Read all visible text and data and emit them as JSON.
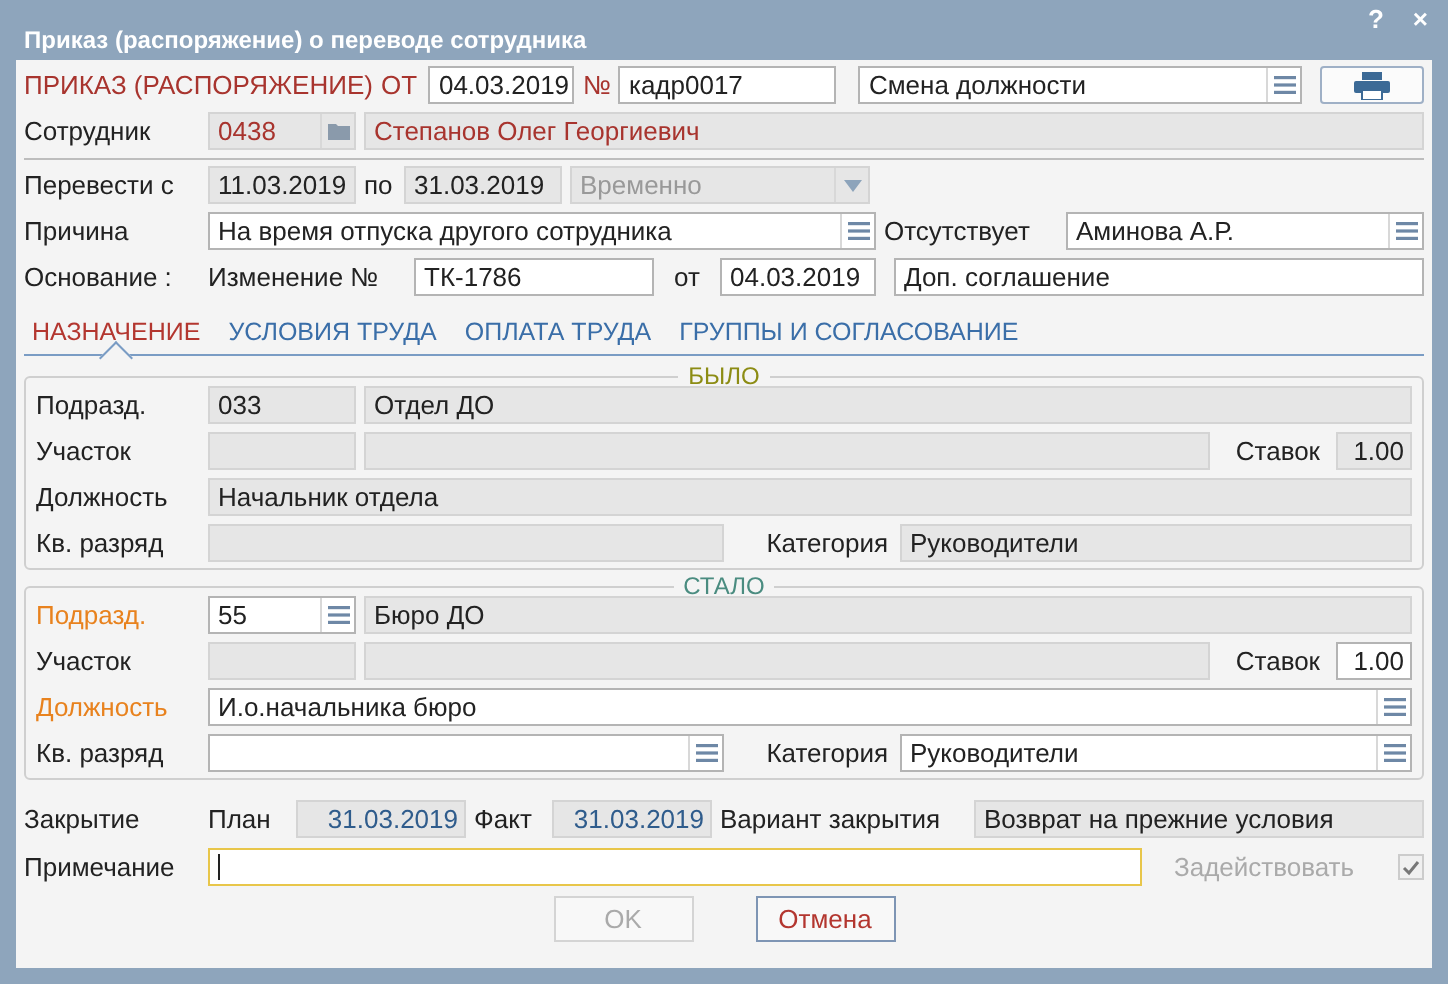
{
  "window": {
    "title": "Приказ (распоряжение) о переводе сотрудника",
    "help": "?",
    "close": "×"
  },
  "order": {
    "title": "ПРИКАЗ (РАСПОРЯЖЕНИЕ)",
    "date_label": "ОТ",
    "date": {
      "value": "04.03.2019",
      "readonly": false
    },
    "number_label": "№",
    "number": {
      "value": "кадр0017",
      "readonly": false
    },
    "type": {
      "value": "Смена должности",
      "readonly": false,
      "menu": true
    }
  },
  "employee": {
    "label": "Сотрудник",
    "code": {
      "value": "0438",
      "readonly": true
    },
    "name": {
      "value": "Степанов Олег Георгиевич",
      "readonly": true
    }
  },
  "transfer": {
    "label": "Перевести с",
    "from": {
      "value": "11.03.2019",
      "readonly": true
    },
    "to_label": "по",
    "to": {
      "value": "31.03.2019",
      "readonly": true
    },
    "mode": {
      "value": "Временно",
      "readonly": true
    }
  },
  "reason": {
    "label": "Причина",
    "value": {
      "value": "На время отпуска другого сотрудника",
      "readonly": false,
      "menu": true
    },
    "absent_label": "Отсутствует",
    "absent": {
      "value": "Аминова А.Р.",
      "readonly": false,
      "menu": true
    }
  },
  "basis": {
    "label": "Основание :",
    "change_label": "Изменение №",
    "change": {
      "value": "ТК-1786",
      "readonly": false
    },
    "date_label": "от",
    "date": {
      "value": "04.03.2019",
      "readonly": false
    },
    "document": {
      "value": "Доп. соглашение",
      "readonly": false
    }
  },
  "tabs": [
    {
      "label": "НАЗНАЧЕНИЕ",
      "selected": true
    },
    {
      "label": "УСЛОВИЯ ТРУДА",
      "selected": false
    },
    {
      "label": "ОПЛАТА ТРУДА",
      "selected": false
    },
    {
      "label": "ГРУППЫ И СОГЛАСОВАНИЕ",
      "selected": false
    }
  ],
  "sections": [
    {
      "legend": "БЫЛО",
      "color": "#8c8c14",
      "subdivision_label": {
        "text": "Подразд.",
        "required": false
      },
      "subdivision_code": {
        "value": "033",
        "readonly": true
      },
      "subdivision_name": {
        "value": "Отдел ДО",
        "readonly": true
      },
      "site_label": {
        "text": "Участок",
        "required": false
      },
      "site_code": {
        "readonly": true
      },
      "site_name": {
        "readonly": true
      },
      "rate_label": "Ставок",
      "rate": {
        "value": "1.00",
        "readonly": true
      },
      "position_label": {
        "text": "Должность",
        "required": false
      },
      "position": {
        "value": "Начальник отдела",
        "readonly": true
      },
      "grade_label": {
        "text": "Кв. разряд",
        "required": false
      },
      "grade": {
        "readonly": true
      },
      "category_label": "Категория",
      "category": {
        "value": "Руководители",
        "readonly": true
      }
    },
    {
      "legend": "СТАЛО",
      "color": "#4a8c80",
      "subdivision_label": {
        "text": "Подразд.",
        "required": true
      },
      "subdivision_code": {
        "value": "55",
        "readonly": false,
        "menu": true
      },
      "subdivision_name": {
        "value": "Бюро ДО",
        "readonly": true
      },
      "site_label": {
        "text": "Участок",
        "required": false
      },
      "site_code": {
        "readonly": true
      },
      "site_name": {
        "readonly": true
      },
      "rate_label": "Ставок",
      "rate": {
        "value": "1.00",
        "readonly": false
      },
      "position_label": {
        "text": "Должность",
        "required": true
      },
      "position": {
        "value": "И.о.начальника бюро",
        "readonly": false,
        "menu": true
      },
      "grade_label": {
        "text": "Кв. разряд",
        "required": false
      },
      "grade": {
        "readonly": false,
        "menu": true
      },
      "category_label": "Категория",
      "category": {
        "value": "Руководители",
        "readonly": false,
        "menu": true
      }
    }
  ],
  "closure": {
    "label": "Закрытие",
    "plan_label": "План",
    "plan": {
      "value": "31.03.2019",
      "readonly": true
    },
    "fact_label": "Факт",
    "fact": {
      "value": "31.03.2019",
      "readonly": true
    },
    "variant_label": "Вариант закрытия",
    "variant": {
      "value": "Возврат на прежние условия",
      "readonly": true
    }
  },
  "note": {
    "label": "Примечание",
    "focused": true
  },
  "activate": {
    "label": "Задействовать",
    "checked": true,
    "disabled": true
  },
  "buttons": [
    {
      "label": "OK",
      "disabled": true
    },
    {
      "label": "Отмена",
      "disabled": false
    }
  ]
}
